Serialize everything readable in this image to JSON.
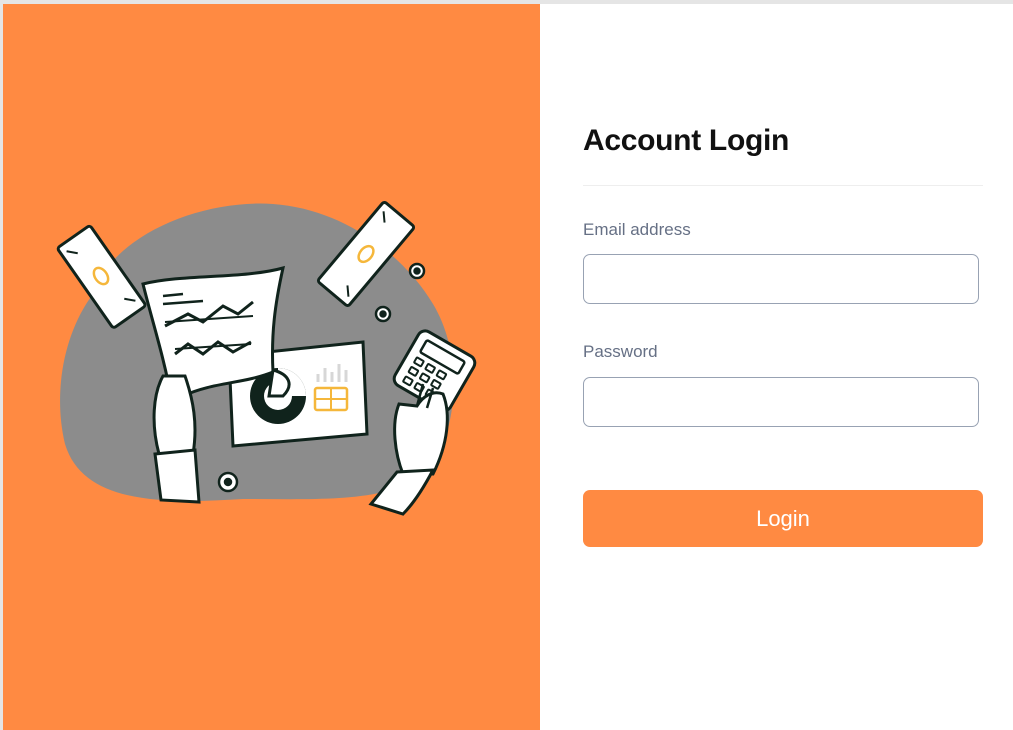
{
  "login": {
    "title": "Account Login",
    "email": {
      "label": "Email address",
      "value": "",
      "placeholder": ""
    },
    "password": {
      "label": "Password",
      "value": "",
      "placeholder": ""
    },
    "submit_label": "Login"
  },
  "illustration": {
    "description_icon": "finance-illustration-icon"
  },
  "colors": {
    "accent": "#ff8a42",
    "blob": "#8c8c8c",
    "outline": "#10231c",
    "highlight": "#f5b73b",
    "label": "#667085",
    "input_border": "#98a2b3"
  }
}
